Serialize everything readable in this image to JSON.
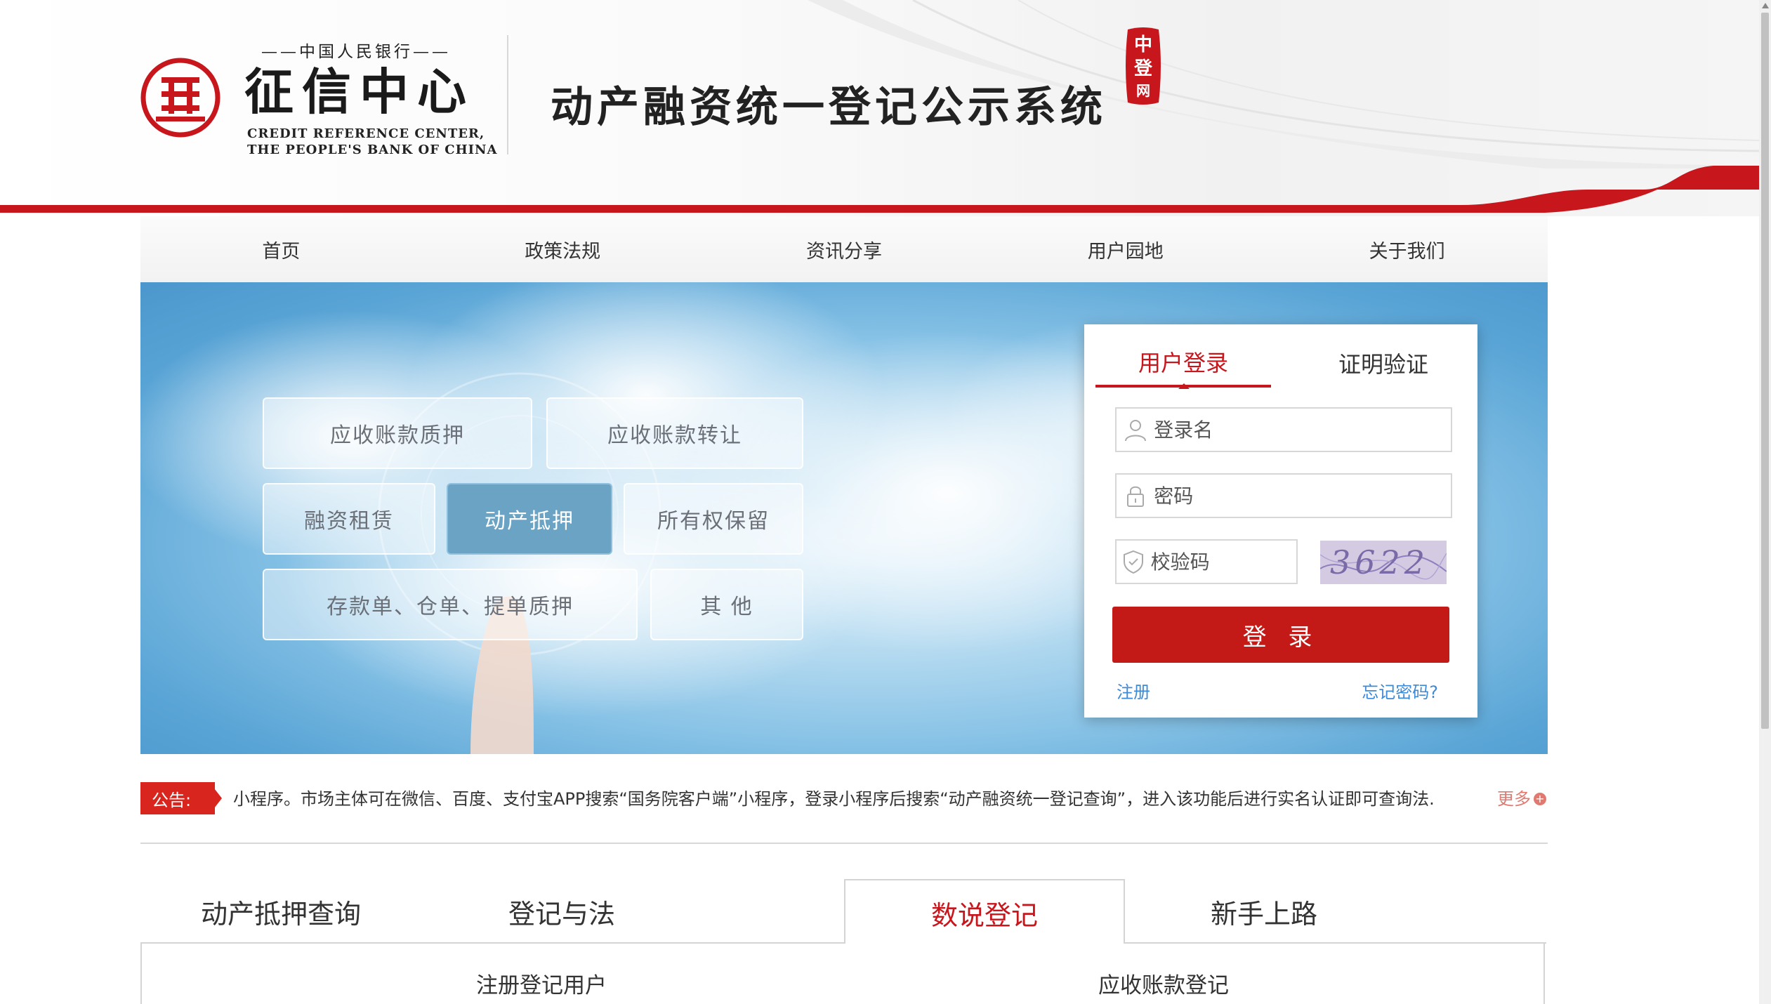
{
  "header": {
    "logo_top_text": "中国人民银行",
    "logo_cn": "征信中心",
    "logo_en_line1": "CREDIT REFERENCE CENTER,",
    "logo_en_line2": "THE PEOPLE'S BANK OF CHINA",
    "system_title": "动产融资统一登记公示系统",
    "seal_chars": [
      "中",
      "登",
      "网"
    ]
  },
  "nav": {
    "items": [
      "首页",
      "政策法规",
      "资讯分享",
      "用户园地",
      "关于我们"
    ]
  },
  "banner": {
    "categories": [
      "应收账款质押",
      "应收账款转让",
      "融资租赁",
      "动产抵押",
      "所有权保留",
      "存款单、仓单、提单质押",
      "其 他"
    ],
    "active_category": "动产抵押"
  },
  "login": {
    "tabs": [
      "用户登录",
      "证明验证"
    ],
    "active_tab": "用户登录",
    "username_placeholder": "登录名",
    "password_placeholder": "密码",
    "captcha_placeholder": "校验码",
    "captcha_text": "3622",
    "submit_label": "登 录",
    "register_label": "注册",
    "forgot_label": "忘记密码?"
  },
  "notice": {
    "label": "公告:",
    "text": "小程序。市场主体可在微信、百度、支付宝APP搜索“国务院客户端”小程序，登录小程序后搜索“动产融资统一登记查询”，进入该功能后进行实名认证即可查询法.",
    "more_label": "更多"
  },
  "bottom_tabs": {
    "items": [
      "动产抵押查询",
      "登记与法",
      "数说登记",
      "新手上路"
    ],
    "active": "数说登记"
  },
  "stats": {
    "left_title": "注册登记用户",
    "right_title": "应收账款登记"
  },
  "colors": {
    "brand_red": "#c8161d",
    "button_red": "#c41a17",
    "link_blue": "#3d8ad6",
    "active_category": "#6aa3c4"
  }
}
